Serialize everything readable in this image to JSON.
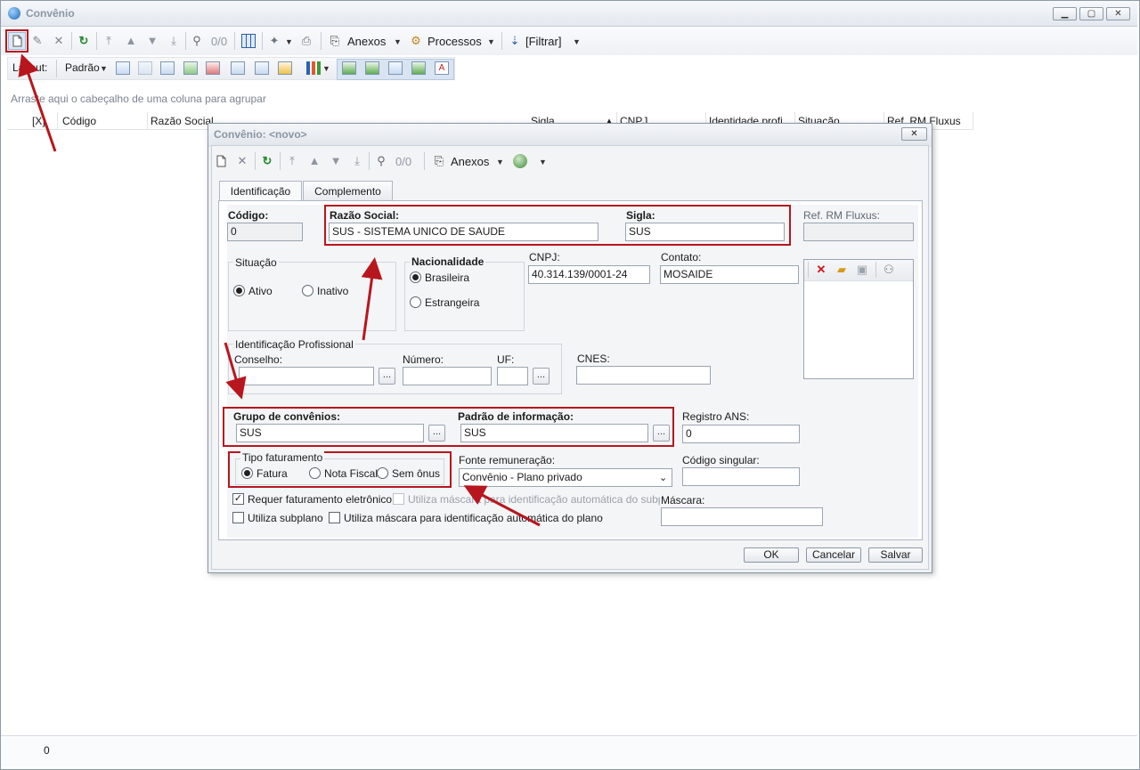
{
  "main": {
    "title": "Convênio",
    "toolbar": {
      "counter": "0/0",
      "anexos": "Anexos",
      "processos": "Processos",
      "filtrar": "[Filtrar]"
    },
    "layout_bar": {
      "layout_label": "Layout:",
      "padrao_label": "Padrão"
    },
    "group_hint": "Arraste aqui o cabeçalho de uma coluna para agrupar",
    "columns": [
      "[X]",
      "Código",
      "Razão Social",
      "Sigla",
      "CNPJ",
      "Identidade profi",
      "Situação",
      "Ref. RM Fluxus"
    ],
    "status_count": "0"
  },
  "dialog": {
    "title": "Convênio: <novo>",
    "toolbar": {
      "counter": "0/0",
      "anexos": "Anexos"
    },
    "tabs": [
      "Identificação",
      "Complemento"
    ],
    "fields": {
      "codigo_label": "Código:",
      "codigo_value": "0",
      "razao_label": "Razão Social:",
      "razao_value": "SUS - SISTEMA UNICO DE SAUDE",
      "sigla_label": "Sigla:",
      "sigla_value": "SUS",
      "ref_label": "Ref. RM Fluxus:",
      "ref_value": "",
      "situacao_label": "Situação",
      "ativo_label": "Ativo",
      "inativo_label": "Inativo",
      "nacionalidade_label": "Nacionalidade",
      "brasileira_label": "Brasileira",
      "estrangeira_label": "Estrangeira",
      "cnpj_label": "CNPJ:",
      "cnpj_value": "40.314.139/0001-24",
      "contato_label": "Contato:",
      "contato_value": "MOSAIDE",
      "id_prof_label": "Identificação Profissional",
      "conselho_label": "Conselho:",
      "numero_label": "Número:",
      "uf_label": "UF:",
      "cnes_label": "CNES:",
      "grupo_label": "Grupo de convênios:",
      "grupo_value": "SUS",
      "padrao_label": "Padrão de informação:",
      "padrao_value": "SUS",
      "registro_label": "Registro ANS:",
      "registro_value": "0",
      "tipo_fat_label": "Tipo faturamento",
      "fatura_label": "Fatura",
      "nota_fiscal_label": "Nota Fiscal",
      "sem_onus_label": "Sem ônus",
      "fonte_label": "Fonte remuneração:",
      "fonte_value": "Convênio - Plano privado",
      "codigo_singular_label": "Código singular:",
      "requer_label": "Requer faturamento eletrônico",
      "mascara_subplano_label": "Utiliza máscara para identificação automática do subplano",
      "utiliza_subplano_label": "Utiliza subplano",
      "mascara_plano_label": "Utiliza máscara para identificação automática do plano",
      "mascara_label": "Máscara:"
    },
    "buttons": {
      "ok": "OK",
      "cancelar": "Cancelar",
      "salvar": "Salvar"
    }
  },
  "colors": {
    "annotation_red": "#b8161e",
    "window_border": "#8e9aa8",
    "dialog_background": "#eef0f3"
  }
}
